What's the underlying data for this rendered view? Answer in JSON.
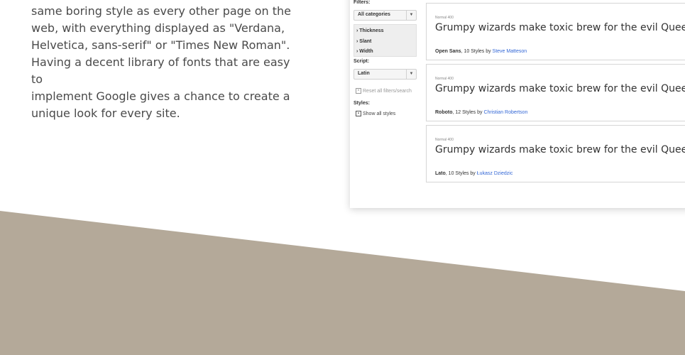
{
  "intro": {
    "text_lines": [
      "same boring style as every other page on the",
      "web, with everything displayed as \"Verdana,",
      "Helvetica, sans-serif\" or \"Times New Roman\".",
      "Having a decent library of fonts that are easy to",
      "implement Google gives a chance to create a",
      "unique look for every site."
    ]
  },
  "screenshot": {
    "sidebar": {
      "filters_label": "Filters:",
      "category_select": "All categories",
      "toggles": [
        "› Thickness",
        "› Slant",
        "› Width"
      ],
      "script_label": "Script:",
      "script_select": "Latin",
      "reset_label": "Reset all filters/search",
      "styles_label": "Styles:",
      "show_all_label": "Show all styles"
    },
    "cards": [
      {
        "meta": "Normal 400",
        "sample": "Grumpy wizards make toxic brew for the evil Queen and Jack.",
        "font_name": "Open Sans",
        "styles": ", 10 Styles by ",
        "author": "Steve Matteson"
      },
      {
        "meta": "Normal 400",
        "sample": "Grumpy wizards make toxic brew for the evil Queen and Jack.",
        "font_name": "Roboto",
        "styles": ", 12 Styles by ",
        "author": "Christian Robertson"
      },
      {
        "meta": "Normal 400",
        "sample": "Grumpy wizards make toxic brew for the evil Queen and Jack.",
        "font_name": "Lato",
        "styles": ", 10 Styles by ",
        "author": "Łukasz Dziedzic"
      }
    ]
  },
  "colors": {
    "band": "#b4a999",
    "body_text": "#4a4a4a",
    "link": "#3367d6"
  }
}
